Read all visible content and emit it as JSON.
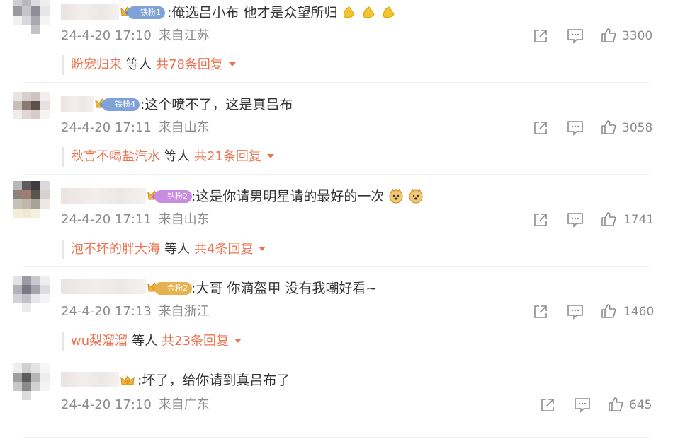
{
  "comments": [
    {
      "badge": "铁粉1",
      "badge_type": "iron",
      "text": ":俺选吕小布 他才是众望所归",
      "time": "24-4-20 17:10",
      "location": "来自江苏",
      "likes": "3300",
      "emoji": [
        "clapping-icon",
        "clapping-icon",
        "clapping-icon"
      ],
      "reply": {
        "user": "盼宠归来",
        "etc": "等人",
        "count": "共78条回复"
      }
    },
    {
      "badge": "铁粉4",
      "badge_type": "iron",
      "text": ":这个喷不了，这是真吕布",
      "time": "24-4-20 17:11",
      "location": "来自山东",
      "likes": "3058",
      "reply": {
        "user": "秋言不喝盐汽水",
        "etc": "等人",
        "count": "共21条回复"
      }
    },
    {
      "badge": "钻粉2",
      "badge_type": "diamond",
      "text": ":这是你请男明星请的最好的一次",
      "time": "24-4-20 17:11",
      "location": "来自山东",
      "likes": "1741",
      "emoji": [
        "doge-icon",
        "doge-icon"
      ],
      "reply": {
        "user": "泡不坏的胖大海",
        "etc": "等人",
        "count": "共4条回复"
      }
    },
    {
      "badge": "金粉2",
      "badge_type": "gold",
      "text": ":大哥 你滴盔甲  没有我嘲好看~",
      "time": "24-4-20 17:13",
      "location": "来自浙江",
      "likes": "1460",
      "reply": {
        "user": "wu梨溜溜",
        "etc": "等人",
        "count": "共23条回复"
      }
    },
    {
      "text": ":坏了，给你请到真吕布了",
      "time": "24-4-20 17:10",
      "location": "来自广东",
      "likes": "645"
    }
  ],
  "icons": {
    "share": "share-icon",
    "comment": "comment-icon",
    "like": "thumb-up-icon",
    "crown": "crown-icon"
  },
  "colors": {
    "reply_accent": "#eb7350",
    "meta_text": "#8c8c8c",
    "body_text": "#333333"
  }
}
